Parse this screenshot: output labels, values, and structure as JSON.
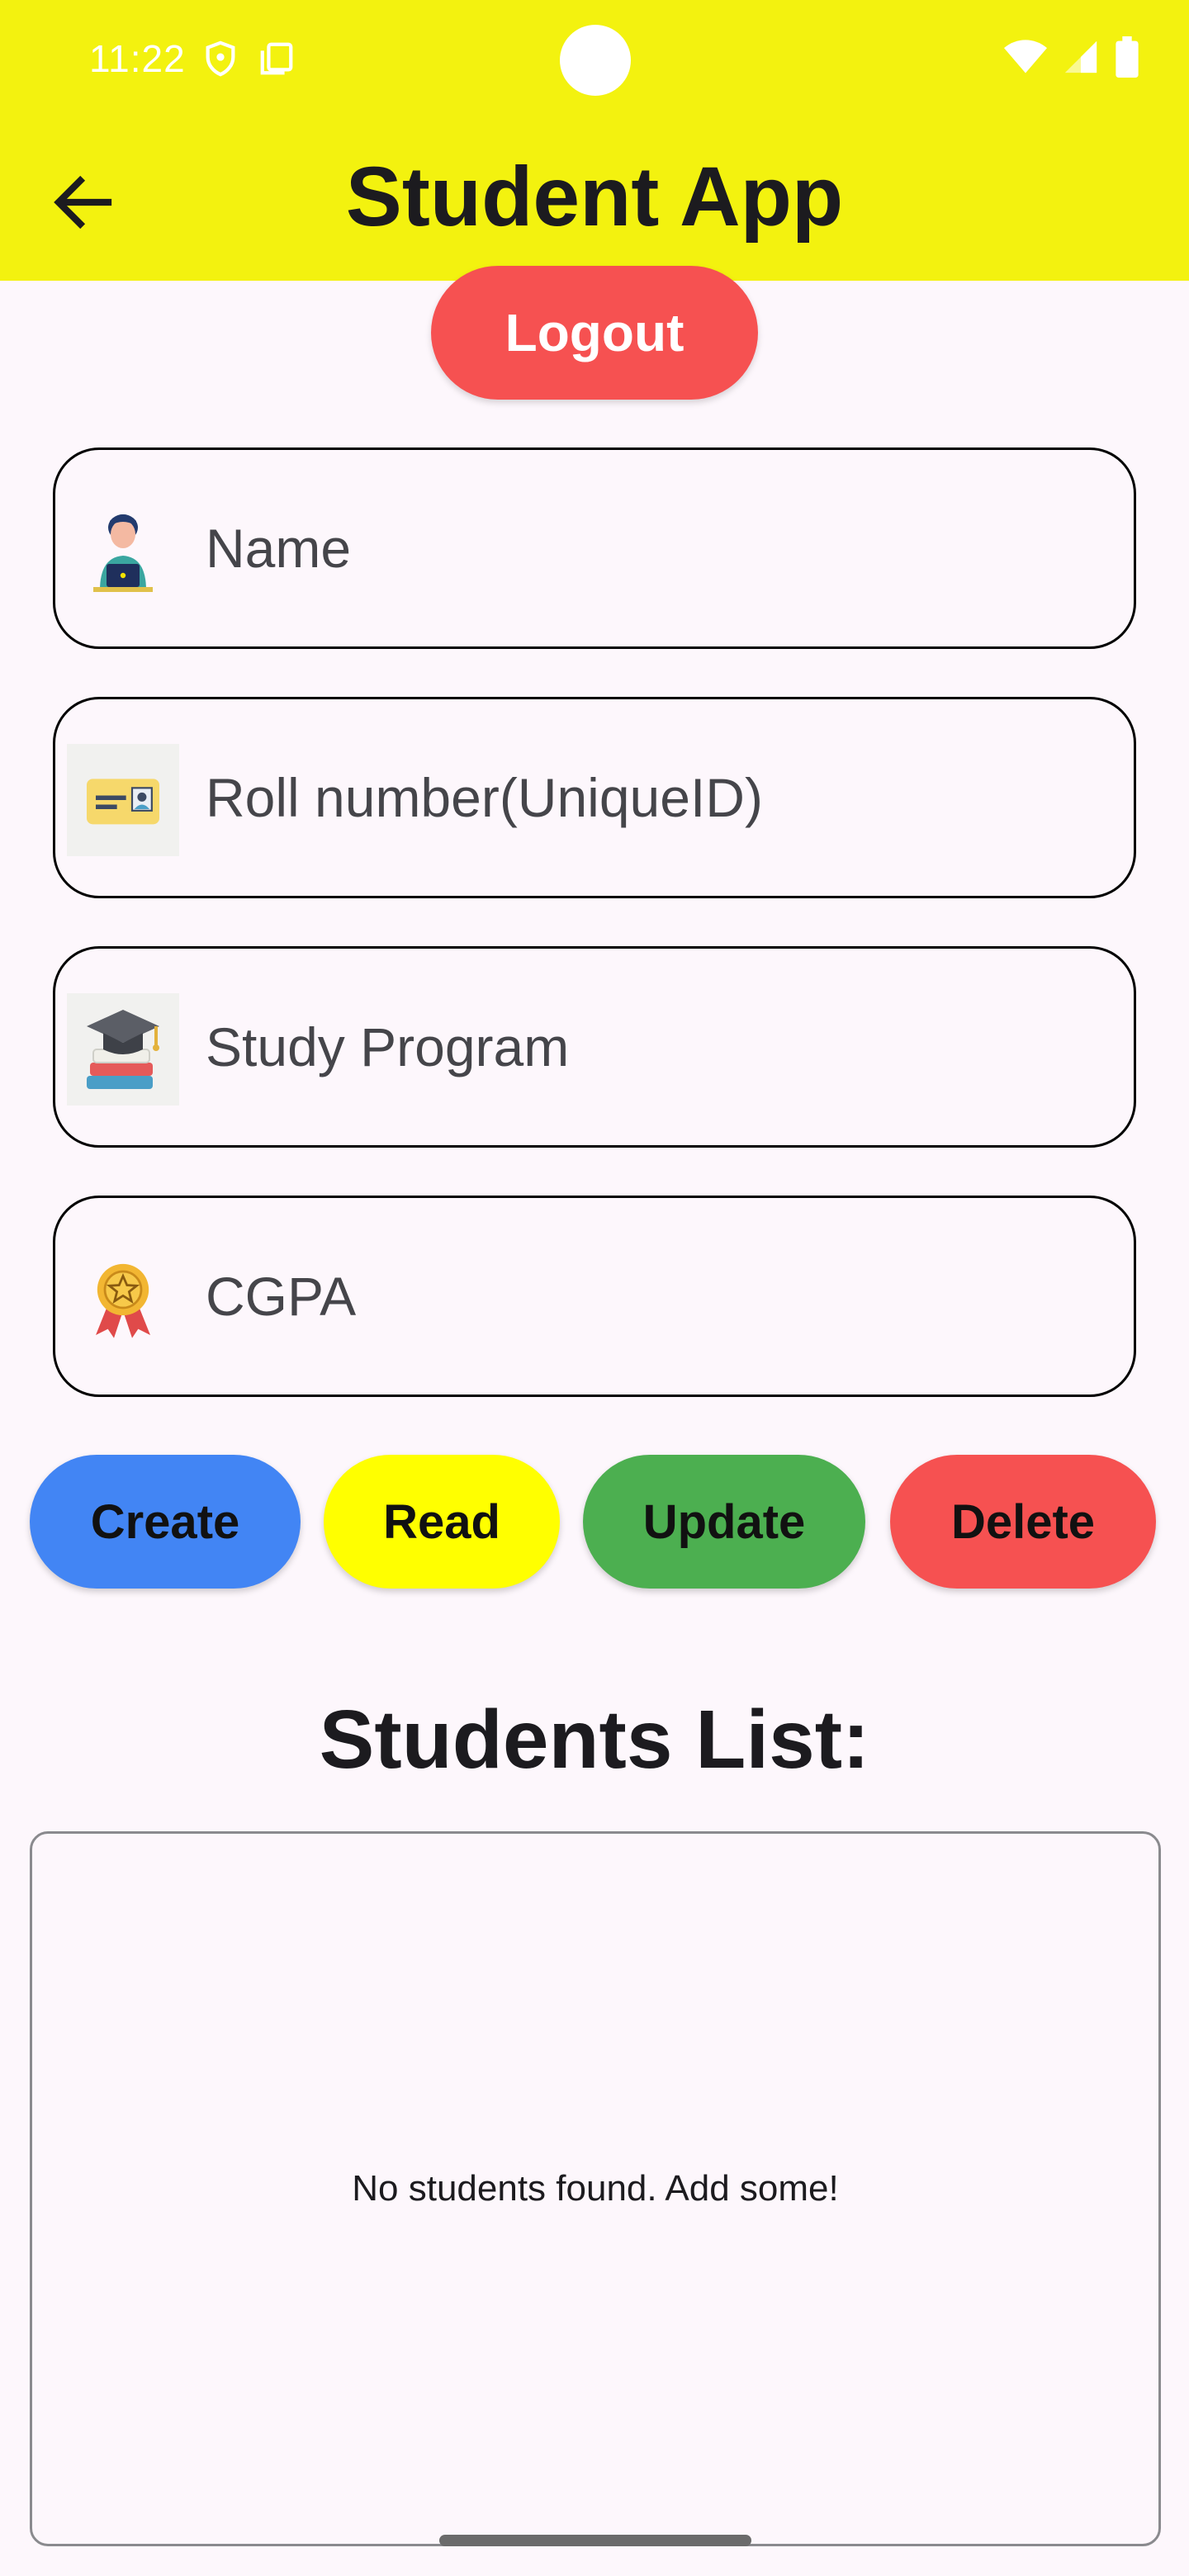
{
  "status_bar": {
    "time": "11:22"
  },
  "header": {
    "title": "Student App",
    "back_icon": "arrow-left-icon"
  },
  "logout_label": "Logout",
  "fields": [
    {
      "placeholder": "Name",
      "icon": "student-laptop-icon"
    },
    {
      "placeholder": "Roll number(UniqueID)",
      "icon": "id-card-icon"
    },
    {
      "placeholder": "Study Program",
      "icon": "graduation-cap-books-icon"
    },
    {
      "placeholder": "CGPA",
      "icon": "award-medal-icon"
    }
  ],
  "actions": {
    "create": "Create",
    "read": "Read",
    "update": "Update",
    "delete": "Delete"
  },
  "colors": {
    "appbar": "#F3F20F",
    "logout": "#F65151",
    "create": "#4285F4",
    "read": "#FFFF00",
    "update": "#4CAF50",
    "delete": "#F65151",
    "background": "#FDF7FC"
  },
  "students_list": {
    "title": "Students List:",
    "empty_message": "No students found. Add some!"
  }
}
